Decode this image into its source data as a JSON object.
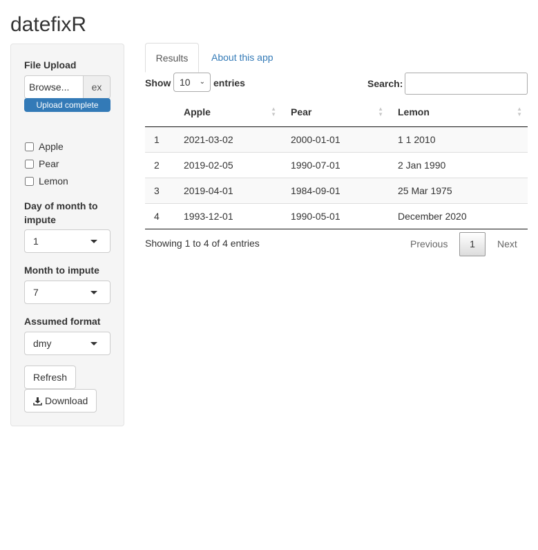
{
  "app": {
    "title": "datefixR"
  },
  "sidebar": {
    "file_upload": {
      "label": "File Upload",
      "browse_label": "Browse...",
      "file_name": "ex",
      "progress_text": "Upload complete",
      "progress_percent": 100
    },
    "columns": [
      {
        "label": "Apple",
        "checked": false
      },
      {
        "label": "Pear",
        "checked": false
      },
      {
        "label": "Lemon",
        "checked": false
      }
    ],
    "day_label": "Day of month to impute",
    "day_value": "1",
    "month_label": "Month to impute",
    "month_value": "7",
    "format_label": "Assumed format",
    "format_value": "dmy",
    "refresh_label": "Refresh",
    "download_label": "Download"
  },
  "tabs": {
    "results": "Results",
    "about": "About this app"
  },
  "table_controls": {
    "show_label": "Show",
    "length_value": "10",
    "entries_label": "entries",
    "search_label": "Search:",
    "search_value": ""
  },
  "table": {
    "headers": [
      "",
      "Apple",
      "Pear",
      "Lemon"
    ],
    "rows": [
      [
        "1",
        "2021-03-02",
        "2000-01-01",
        "1 1 2010"
      ],
      [
        "2",
        "2019-02-05",
        "1990-07-01",
        "2 Jan 1990"
      ],
      [
        "3",
        "2019-04-01",
        "1984-09-01",
        "25 Mar 1975"
      ],
      [
        "4",
        "1993-12-01",
        "1990-05-01",
        "December 2020"
      ]
    ]
  },
  "footer": {
    "info": "Showing 1 to 4 of 4 entries",
    "previous_label": "Previous",
    "current_page": "1",
    "next_label": "Next"
  },
  "colors": {
    "accent": "#337ab7",
    "sidebar_bg": "#f5f5f5"
  },
  "icons": {
    "download": "download-icon",
    "dropdown": "chevron-down-icon",
    "sort": "sort-arrows-icon"
  }
}
